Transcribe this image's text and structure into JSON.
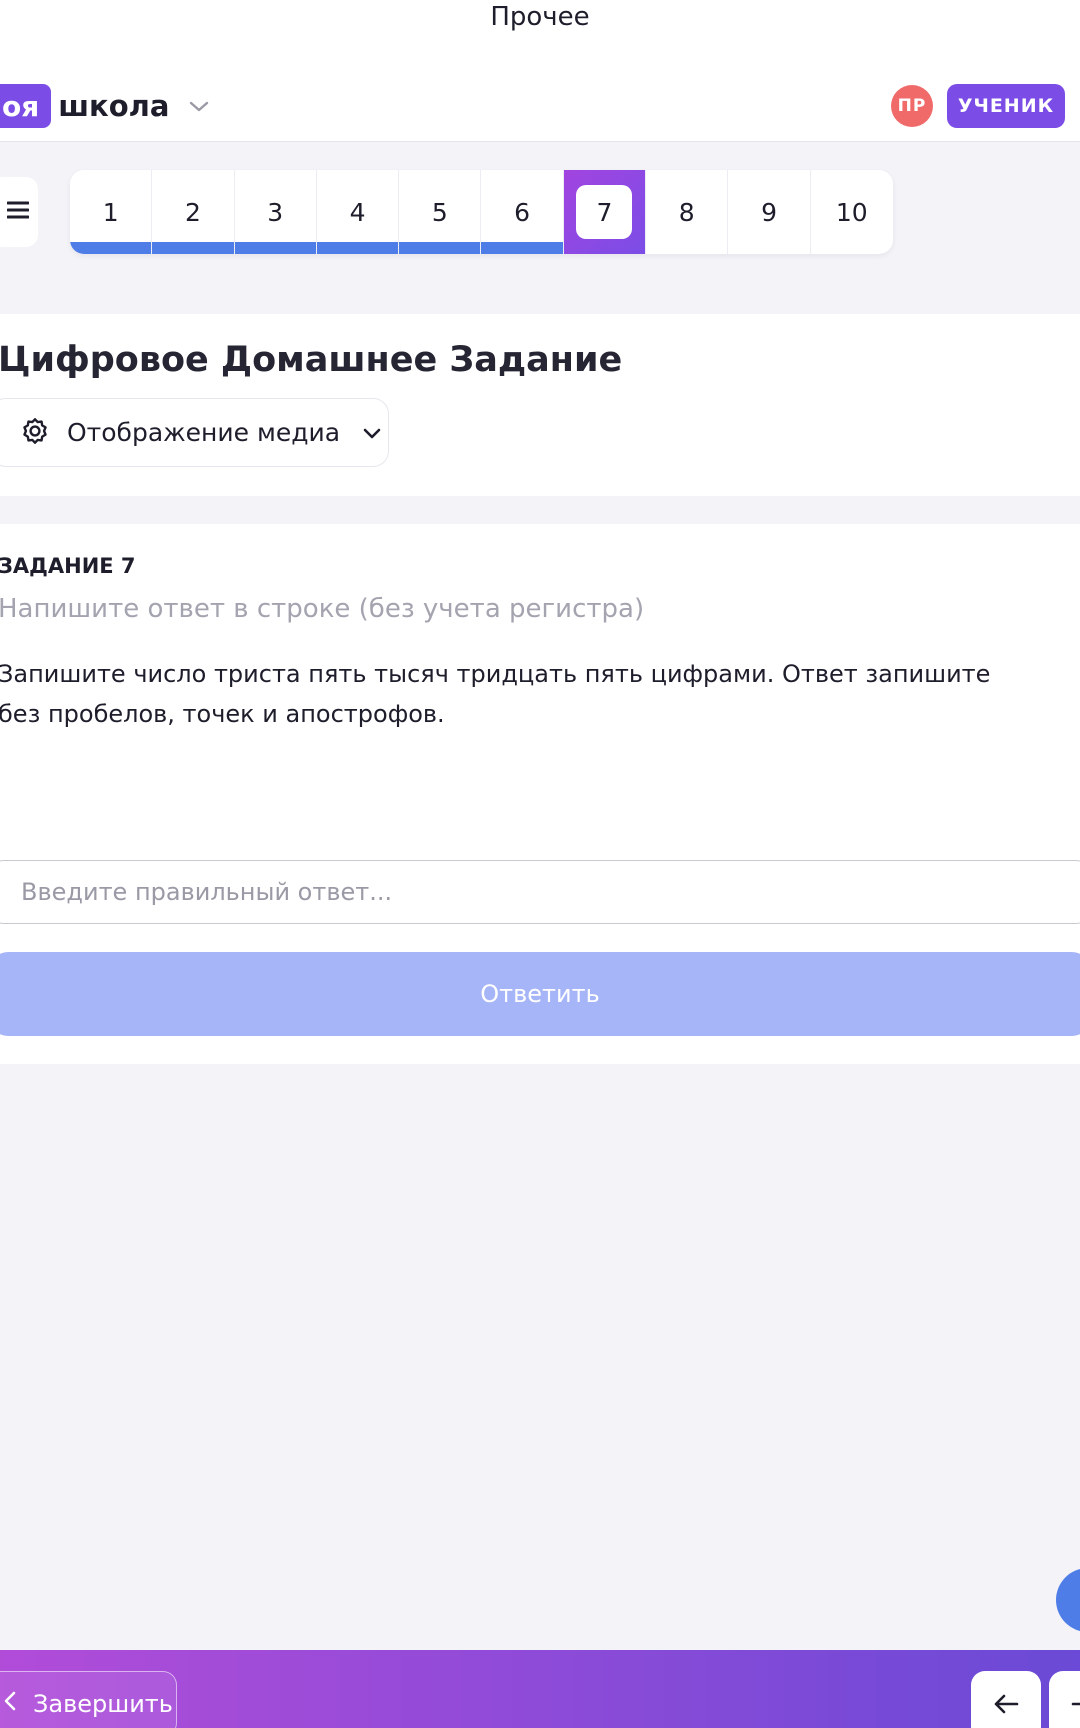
{
  "header": {
    "top_title": "Прочее",
    "brand_badge": "оя",
    "brand_word": "школа",
    "avatar_initials": "ПР",
    "role_badge": "УЧЕНИК"
  },
  "pager": {
    "pages": [
      "1",
      "2",
      "3",
      "4",
      "5",
      "6",
      "7",
      "8",
      "9",
      "10"
    ],
    "active_page": "7",
    "completed_pages": [
      "1",
      "2",
      "3",
      "4",
      "5",
      "6"
    ]
  },
  "homework": {
    "title": "Цифровое Домашнее Задание",
    "media_toggle_label": "Отображение медиа"
  },
  "task": {
    "label": "ЗАДАНИЕ 7",
    "hint": "Напишите ответ в строке (без учета регистра)",
    "text": "Запишите число триста пять тысяч тридцать пять цифрами. Ответ запишите без пробелов, точек и апострофов.",
    "input_placeholder": "Введите правильный ответ...",
    "input_value": "",
    "submit_label": "Ответить"
  },
  "footer": {
    "finish_label": "Завершить"
  },
  "colors": {
    "accent": "#7b4de6",
    "progress": "#4f7de8",
    "submit_disabled": "#a6b5f7",
    "avatar": "#f06a6a"
  }
}
